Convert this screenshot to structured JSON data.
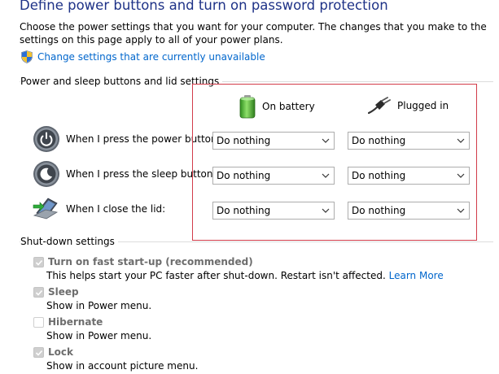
{
  "page": {
    "title": "Define power buttons and turn on password protection",
    "description": "Choose the power settings that you want for your computer. The changes that you make to the settings on this page apply to all of your power plans.",
    "change_link": "Change settings that are currently unavailable"
  },
  "power_sleep": {
    "group_label": "Power and sleep buttons and lid settings",
    "columns": {
      "battery": "On battery",
      "plugged": "Plugged in"
    },
    "rows": [
      {
        "label": "When I press the power button:",
        "battery": "Do nothing",
        "plugged": "Do nothing",
        "icon": "power-button-icon"
      },
      {
        "label": "When I press the sleep button:",
        "battery": "Do nothing",
        "plugged": "Do nothing",
        "icon": "sleep-button-icon"
      },
      {
        "label": "When I close the lid:",
        "battery": "Do nothing",
        "plugged": "Do nothing",
        "icon": "laptop-lid-icon"
      }
    ]
  },
  "shutdown": {
    "group_label": "Shut-down settings",
    "items": [
      {
        "label": "Turn on fast start-up (recommended)",
        "checked": true,
        "description": "This helps start your PC faster after shut-down. Restart isn't affected.",
        "link": "Learn More"
      },
      {
        "label": "Sleep",
        "checked": true,
        "description": "Show in Power menu."
      },
      {
        "label": "Hibernate",
        "checked": false,
        "description": "Show in Power menu."
      },
      {
        "label": "Lock",
        "checked": true,
        "description": "Show in account picture menu."
      }
    ]
  },
  "colors": {
    "title": "#1e3287",
    "link": "#0066cc",
    "highlight_border": "#d23c4a",
    "disabled_text": "#6d6d6d"
  }
}
